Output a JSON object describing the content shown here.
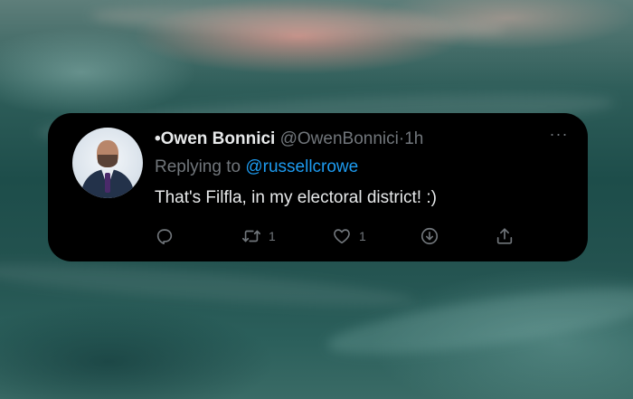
{
  "tweet": {
    "author_name": "•Owen Bonnici",
    "author_handle": "@OwenBonnici",
    "separator": "·",
    "timestamp": "1h",
    "more_icon": "more-horizontal-icon",
    "replying_prefix": "Replying to",
    "replying_handle": "@russellcrowe",
    "text": "That's Filfla, in my electoral district! :)",
    "actions": {
      "reply": {
        "icon": "reply-icon"
      },
      "retweet": {
        "icon": "retweet-icon",
        "count": "1"
      },
      "like": {
        "icon": "heart-icon",
        "count": "1"
      },
      "download": {
        "icon": "download-icon"
      },
      "share": {
        "icon": "share-icon"
      }
    }
  },
  "colors": {
    "card_background": "#000000",
    "primary_text": "#e7e9ea",
    "secondary_text": "#71767b",
    "link": "#1d9bf0"
  }
}
